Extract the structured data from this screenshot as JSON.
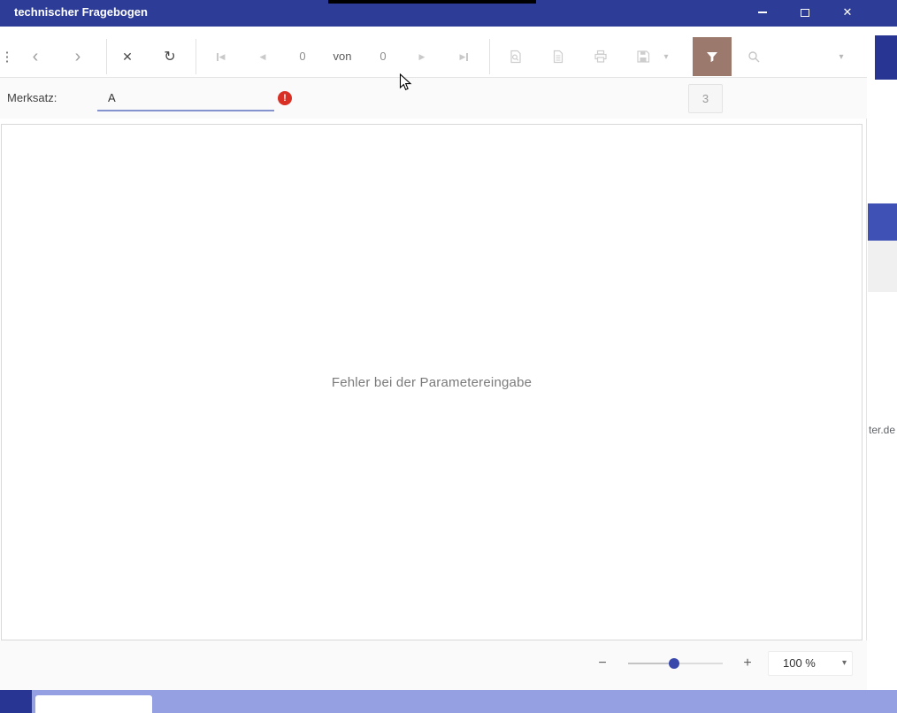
{
  "window": {
    "title": "technischer Fragebogen"
  },
  "toolbar": {
    "current_page": "0",
    "of_label": "von",
    "total_pages": "0",
    "search_value": ""
  },
  "parameters": {
    "label": "Merksatz:",
    "value": "A",
    "panel_toggle_label": "3"
  },
  "content": {
    "message": "Fehler bei der Parametereingabe"
  },
  "statusbar": {
    "zoom_value": "100 %"
  },
  "background": {
    "partial_text": "ter.de"
  },
  "icons": {
    "menu_dots": "⋮",
    "back": "‹",
    "forward": "›",
    "stop": "✕",
    "refresh": "↻",
    "first_page": "◀",
    "prev_page": "◀",
    "next_page": "▶",
    "last_page": "▶",
    "caret_down": "▾",
    "close": "✕",
    "error": "!",
    "zoom_out": "−",
    "zoom_in": "+"
  },
  "colors": {
    "titlebar": "#2d3c96",
    "accent_blue": "#3f51b5",
    "filter_active_bg": "#9c796d",
    "error_red": "#d93025",
    "underline_blue": "#8493ce",
    "taskbar_strip": "#95a0e3"
  }
}
